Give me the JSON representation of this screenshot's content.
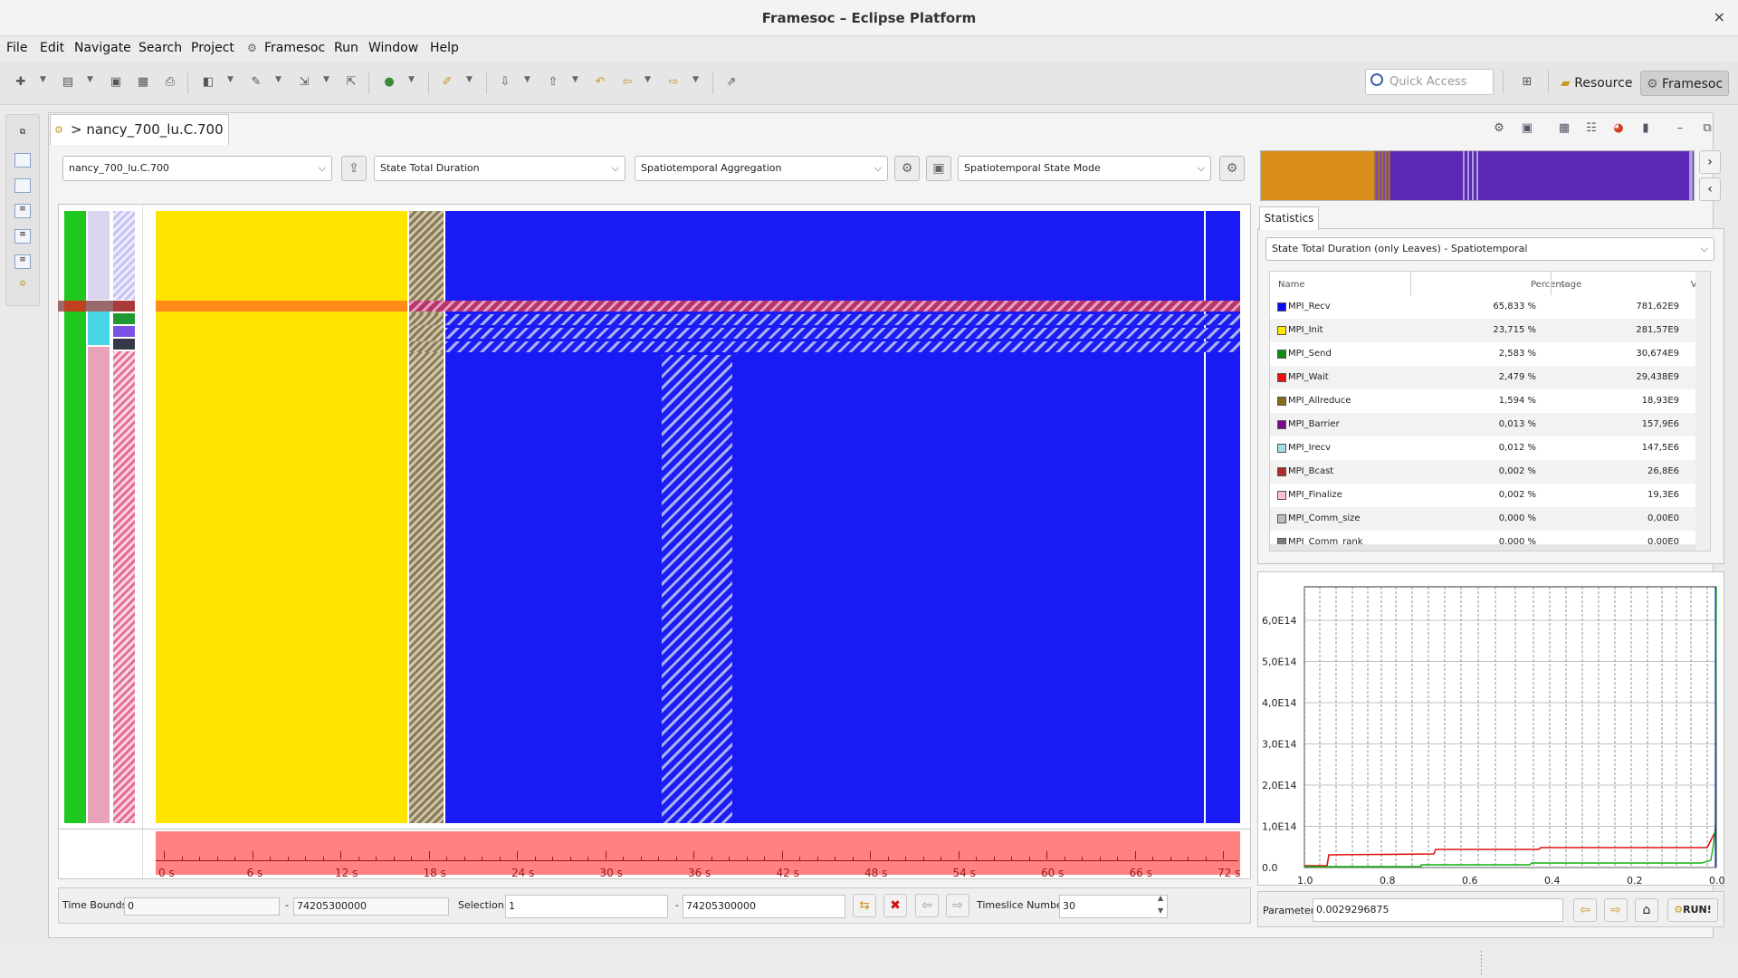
{
  "window": {
    "title": "Framesoc – Eclipse Platform",
    "close": "×"
  },
  "menu": [
    "File",
    "Edit",
    "Navigate",
    "Search",
    "Project",
    "Framesoc",
    "Run",
    "Window",
    "Help"
  ],
  "toolbar": {
    "quick_access_placeholder": "Quick Access",
    "perspectives": [
      "Resource",
      "Framesoc"
    ]
  },
  "editor": {
    "tab_title": "> nancy_700_lu.C.700",
    "tab_close": "⊠"
  },
  "controls": {
    "trace_combo": "nancy_700_lu.C.700",
    "operator_combo": "State Total Duration",
    "aggregation_combo": "Spatiotemporal Aggregation",
    "mode_combo": "Spatiotemporal State Mode"
  },
  "timeline": {
    "ticks": [
      "0 s",
      "6 s",
      "12 s",
      "18 s",
      "24 s",
      "30 s",
      "36 s",
      "42 s",
      "48 s",
      "54 s",
      "60 s",
      "66 s",
      "72 s"
    ]
  },
  "bounds": {
    "time_bounds_label": "Time Bounds:",
    "time_start": "0",
    "dash": "-",
    "time_end": "74205300000",
    "selection_label": "Selection:",
    "sel_start": "1",
    "sel_end": "74205300000",
    "timeslice_label": "Timeslice Number",
    "timeslice_value": "30"
  },
  "statistics": {
    "tab": "Statistics",
    "combo": "State Total Duration (only Leaves) - Spatiotemporal",
    "headers": {
      "name": "Name",
      "percentage": "Percentage",
      "value": "Valu"
    },
    "rows": [
      {
        "name": "MPI_Recv",
        "pct": "65,833 %",
        "val": "781,62E9",
        "color": "#0a0af0"
      },
      {
        "name": "MPI_Init",
        "pct": "23,715 %",
        "val": "281,57E9",
        "color": "#ffe600"
      },
      {
        "name": "MPI_Send",
        "pct": "2,583 %",
        "val": "30,674E9",
        "color": "#108c10"
      },
      {
        "name": "MPI_Wait",
        "pct": "2,479 %",
        "val": "29,438E9",
        "color": "#f01010"
      },
      {
        "name": "MPI_Allreduce",
        "pct": "1,594 %",
        "val": "18,93E9",
        "color": "#8a6a1a"
      },
      {
        "name": "MPI_Barrier",
        "pct": "0,013 %",
        "val": "157,9E6",
        "color": "#7a0a8a"
      },
      {
        "name": "MPI_Irecv",
        "pct": "0,012 %",
        "val": "147,5E6",
        "color": "#a6d8ec"
      },
      {
        "name": "MPI_Bcast",
        "pct": "0,002 %",
        "val": "26,8E6",
        "color": "#b02828"
      },
      {
        "name": "MPI_Finalize",
        "pct": "0,002 %",
        "val": "19,3E6",
        "color": "#f8c0d4"
      },
      {
        "name": "MPI_Comm_size",
        "pct": "0,000 %",
        "val": "0,00E0",
        "color": "#bdbdbd"
      },
      {
        "name": "MPI_Comm_rank",
        "pct": "0,000 %",
        "val": "0,00E0",
        "color": "#7a7a7a"
      }
    ]
  },
  "histogram": {
    "y_ticks": [
      "6,0E14",
      "5,0E14",
      "4,0E14",
      "3,0E14",
      "2,0E14",
      "1,0E14",
      "0.0"
    ],
    "x_ticks": [
      "1.0",
      "0.8",
      "0.6",
      "0.4",
      "0.2",
      "0.0"
    ]
  },
  "parameter": {
    "label": "Parameter",
    "value": "0.0029296875",
    "run": "RUN!"
  }
}
